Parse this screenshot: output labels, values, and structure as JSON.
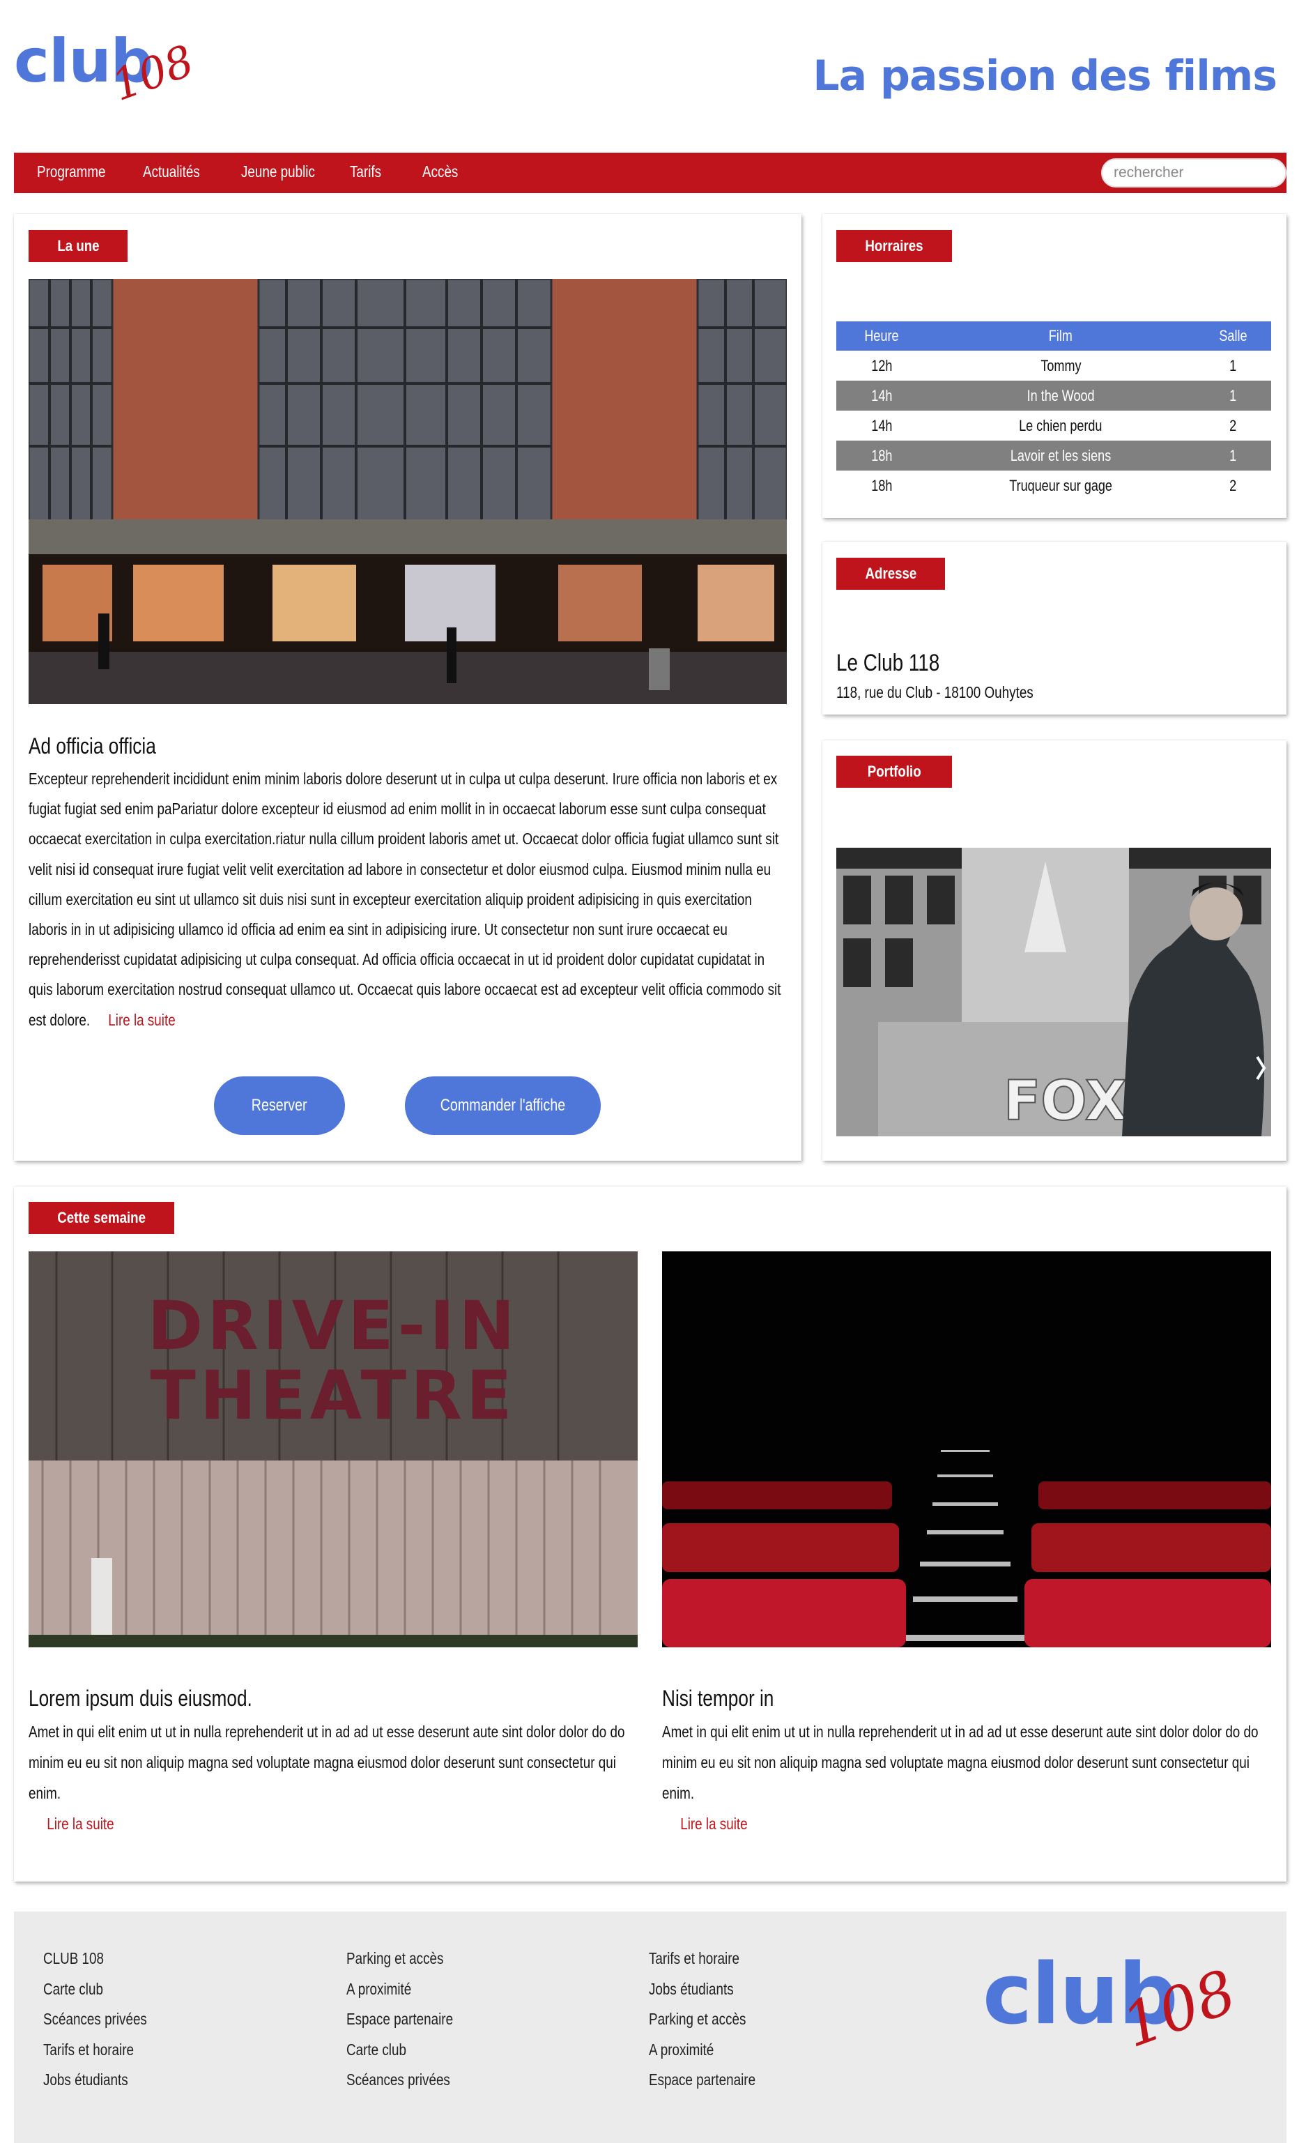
{
  "header": {
    "logo": {
      "word": "club",
      "number": "108"
    },
    "tagline": "La passion des films"
  },
  "nav": {
    "items": [
      "Programme",
      "Actualités",
      "Jeune public",
      "Tarifs",
      "Accès"
    ],
    "search_placeholder": "rechercher"
  },
  "la_une": {
    "badge": "La une",
    "title": "Ad officia officia",
    "body": "Excepteur reprehenderit incididunt enim minim laboris dolore deserunt ut in culpa ut culpa deserunt. Irure officia non laboris et ex fugiat fugiat sed enim paPariatur dolore excepteur id eiusmod ad enim mollit in in occaecat laborum esse sunt culpa consequat occaecat exercitation in culpa exercitation.riatur nulla cillum proident laboris amet ut. Occaecat dolor officia fugiat ullamco sunt sit velit nisi id consequat irure fugiat velit velit exercitation ad labore in consectetur et dolor eiusmod culpa. Eiusmod minim nulla eu cillum exercitation eu sint ut ullamco sit duis nisi sunt in excepteur exercitation aliquip proident adipisicing in quis exercitation laboris in in ut adipisicing ullamco id officia ad enim ea sint in adipisicing irure. Ut consectetur non sunt irure occaecat eu reprehenderisst cupidatat adipisicing ut culpa consequat. Ad officia officia occaecat in ut id proident dolor cupidatat cupidatat in quis laborum exercitation nostrud consequat ullamco ut. Occaecat quis labore occaecat est ad excepteur velit officia commodo sit est dolore.",
    "read_more": "Lire la suite",
    "reserve_button": "Reserver",
    "poster_button": "Commander l'affiche"
  },
  "horaires": {
    "badge": "Horraires",
    "headers": [
      "Heure",
      "Film",
      "Salle"
    ],
    "rows": [
      [
        "12h",
        "Tommy",
        "1"
      ],
      [
        "14h",
        "In the Wood",
        "1"
      ],
      [
        "14h",
        "Le chien perdu",
        "2"
      ],
      [
        "18h",
        "Lavoir et les siens",
        "1"
      ],
      [
        "18h",
        "Truqueur sur gage",
        "2"
      ]
    ]
  },
  "adresse": {
    "badge": "Adresse",
    "name": "Le Club 118",
    "line": "118, rue du Club - 18100 Ouhytes"
  },
  "portfolio": {
    "badge": "Portfolio",
    "sign": "FOX"
  },
  "semaine": {
    "badge": "Cette semaine",
    "drive_in_text_1": "DRIVE-IN",
    "drive_in_text_2": "THEATRE",
    "cards": [
      {
        "title": "Lorem ipsum duis eiusmod.",
        "body": "Amet in qui elit enim ut ut in nulla reprehenderit ut in ad ad ut esse deserunt aute sint dolor dolor do do minim eu eu sit non aliquip magna sed voluptate magna eiusmod dolor deserunt sunt consectetur qui enim.",
        "read_more": "Lire la suite"
      },
      {
        "title": "Nisi tempor in",
        "body": "Amet in qui elit enim ut ut in nulla reprehenderit ut in ad ad ut esse deserunt aute sint dolor dolor do do minim eu eu sit non aliquip magna sed voluptate magna eiusmod dolor deserunt sunt consectetur qui enim.",
        "read_more": "Lire la suite"
      }
    ]
  },
  "footer": {
    "col1": [
      "CLUB 108",
      "Carte club",
      "Scéances privées",
      "Tarifs et horaire",
      "Jobs étudiants"
    ],
    "col2": [
      "Parking et accès",
      "A proximité",
      "Espace partenaire",
      "Carte club",
      "Scéances privées"
    ],
    "col3": [
      "Tarifs et horaire",
      "Jobs étudiants",
      "Parking et accès",
      "A proximité",
      "Espace partenaire"
    ],
    "logo": {
      "word": "club",
      "number": "108"
    }
  },
  "colors": {
    "accent_red": "#c0141c",
    "accent_blue": "#4f76d9",
    "footer_bg": "#ebebeb"
  }
}
